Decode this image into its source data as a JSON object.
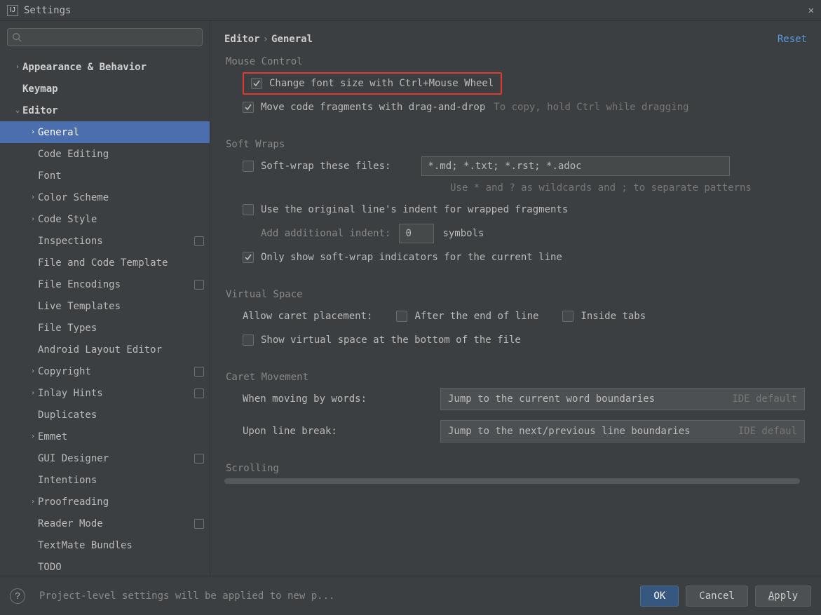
{
  "window": {
    "title": "Settings"
  },
  "sidebar": {
    "search_placeholder": "",
    "items": [
      {
        "label": "Appearance & Behavior",
        "expandable": true,
        "bold": true,
        "depth": 0
      },
      {
        "label": "Keymap",
        "expandable": false,
        "bold": true,
        "depth": 0
      },
      {
        "label": "Editor",
        "expandable": true,
        "expanded": true,
        "bold": true,
        "depth": 0
      },
      {
        "label": "General",
        "expandable": true,
        "depth": 1,
        "selected": true
      },
      {
        "label": "Code Editing",
        "depth": 1
      },
      {
        "label": "Font",
        "depth": 1
      },
      {
        "label": "Color Scheme",
        "expandable": true,
        "depth": 1
      },
      {
        "label": "Code Style",
        "expandable": true,
        "depth": 1
      },
      {
        "label": "Inspections",
        "depth": 1,
        "proj": true
      },
      {
        "label": "File and Code Template",
        "depth": 1
      },
      {
        "label": "File Encodings",
        "depth": 1,
        "proj": true
      },
      {
        "label": "Live Templates",
        "depth": 1
      },
      {
        "label": "File Types",
        "depth": 1
      },
      {
        "label": "Android Layout Editor",
        "depth": 1
      },
      {
        "label": "Copyright",
        "expandable": true,
        "depth": 1,
        "proj": true
      },
      {
        "label": "Inlay Hints",
        "expandable": true,
        "depth": 1,
        "proj": true
      },
      {
        "label": "Duplicates",
        "depth": 1
      },
      {
        "label": "Emmet",
        "expandable": true,
        "depth": 1
      },
      {
        "label": "GUI Designer",
        "depth": 1,
        "proj": true
      },
      {
        "label": "Intentions",
        "depth": 1
      },
      {
        "label": "Proofreading",
        "expandable": true,
        "depth": 1
      },
      {
        "label": "Reader Mode",
        "depth": 1,
        "proj": true
      },
      {
        "label": "TextMate Bundles",
        "depth": 1
      },
      {
        "label": "TODO",
        "depth": 1
      }
    ]
  },
  "header": {
    "breadcrumb": [
      "Editor",
      "General"
    ],
    "reset": "Reset"
  },
  "sections": {
    "mouse": {
      "title": "Mouse Control",
      "change_font": {
        "label": "Change font size with Ctrl+Mouse Wheel",
        "checked": true
      },
      "move_frag": {
        "label": "Move code fragments with drag-and-drop",
        "checked": true,
        "hint": "To copy, hold Ctrl while dragging"
      }
    },
    "soft": {
      "title": "Soft Wraps",
      "wrap_files": {
        "label": "Soft-wrap these files:",
        "checked": false,
        "value": "*.md; *.txt; *.rst; *.adoc",
        "hint": "Use * and ? as wildcards and ; to separate patterns"
      },
      "orig_indent": {
        "label": "Use the original line's indent for wrapped fragments",
        "checked": false
      },
      "add_indent": {
        "label": "Add additional indent:",
        "value": "0",
        "suffix": "symbols"
      },
      "only_show": {
        "label": "Only show soft-wrap indicators for the current line",
        "checked": true
      }
    },
    "virtual": {
      "title": "Virtual Space",
      "caret_label": "Allow caret placement:",
      "after_eol": {
        "label": "After the end of line",
        "checked": false
      },
      "inside_tabs": {
        "label": "Inside tabs",
        "checked": false
      },
      "show_vs_bottom": {
        "label": "Show virtual space at the bottom of the file",
        "checked": false
      }
    },
    "caret": {
      "title": "Caret Movement",
      "by_words": {
        "label": "When moving by words:",
        "value": "Jump to the current word boundaries",
        "hint": "IDE default"
      },
      "line_break": {
        "label": "Upon line break:",
        "value": "Jump to the next/previous line boundaries",
        "hint": "IDE defaul"
      }
    },
    "scrolling": {
      "title": "Scrolling"
    }
  },
  "footer": {
    "hint": "Project-level settings will be applied to new p...",
    "ok": "OK",
    "cancel": "Cancel",
    "apply_pre": "A",
    "apply_rest": "pply"
  }
}
